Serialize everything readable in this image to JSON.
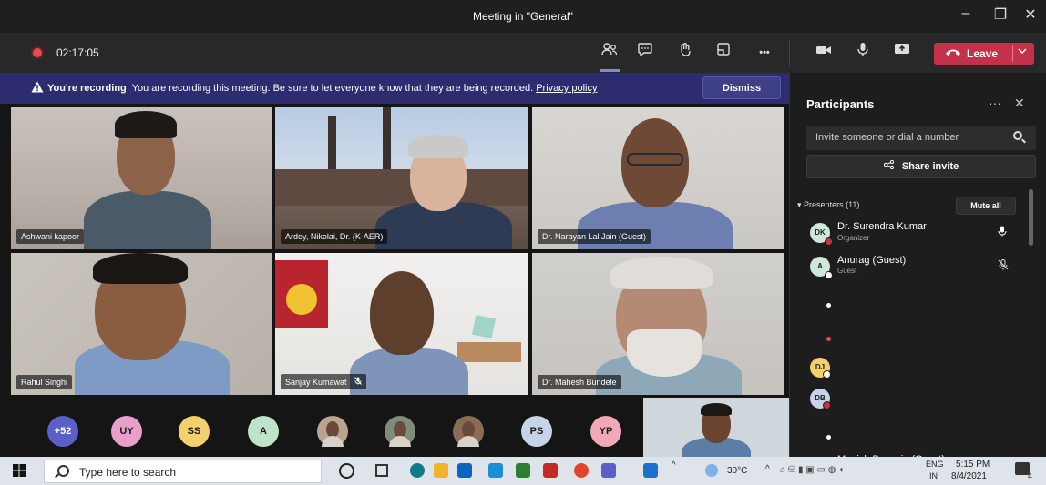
{
  "window": {
    "title": "Meeting in \"General\"",
    "minimize": "–",
    "maximize": "❐",
    "close": "✕"
  },
  "toolbar": {
    "timer": "02:17:05",
    "more": "•••",
    "leave_label": "Leave"
  },
  "recording_banner": {
    "bold": "You're recording",
    "message": "You are recording this meeting. Be sure to let everyone know that they are being recorded.",
    "link": "Privacy policy",
    "dismiss": "Dismiss"
  },
  "tiles": [
    {
      "name": "Ashwani kapoor"
    },
    {
      "name": "Ardey, Nikolai, Dr. (K-AER)"
    },
    {
      "name": "Dr. Narayan Lal Jain (Guest)"
    },
    {
      "name": "Rahul Singhi"
    },
    {
      "name": "Sanjay Kumawat"
    },
    {
      "name": "Dr. Mahesh Bundele"
    }
  ],
  "avatar_row": [
    {
      "label": "+52",
      "color": "#5b5fc7",
      "text_color": "#ffffff"
    },
    {
      "label": "UY",
      "color": "#e8a0c8"
    },
    {
      "label": "SS",
      "color": "#f2d06b"
    },
    {
      "label": "A",
      "color": "#bfe3c9"
    },
    {
      "label": "",
      "color": "#b8a48f"
    },
    {
      "label": "",
      "color": "#7d8d7a"
    },
    {
      "label": "",
      "color": "#8a6b55"
    },
    {
      "label": "PS",
      "color": "#c7d3e6"
    },
    {
      "label": "YP",
      "color": "#f3a8b8"
    }
  ],
  "panel": {
    "title": "Participants",
    "more": "···",
    "close": "✕",
    "invite_placeholder": "Invite someone or dial a number",
    "share_invite": "Share invite",
    "presenters_header": "Presenters (11)",
    "mute_all": "Mute all",
    "participants": [
      {
        "initials": "DK",
        "name": "Dr. Surendra Kumar",
        "role": "Organizer",
        "status_color": "#c4314b"
      },
      {
        "initials": "A",
        "name": "Anurag (Guest)",
        "role": "Guest",
        "status_color": "#ffffff"
      }
    ],
    "more_initials": [
      "DJ",
      "DB"
    ],
    "cut_name": "Munish Baweria (Guest)"
  },
  "taskbar": {
    "search_placeholder": "Type here to search",
    "temperature": "30°C",
    "lang_top": "ENG",
    "lang_bottom": "IN",
    "time": "5:15 PM",
    "date": "8/4/2021",
    "notifications": "4"
  }
}
